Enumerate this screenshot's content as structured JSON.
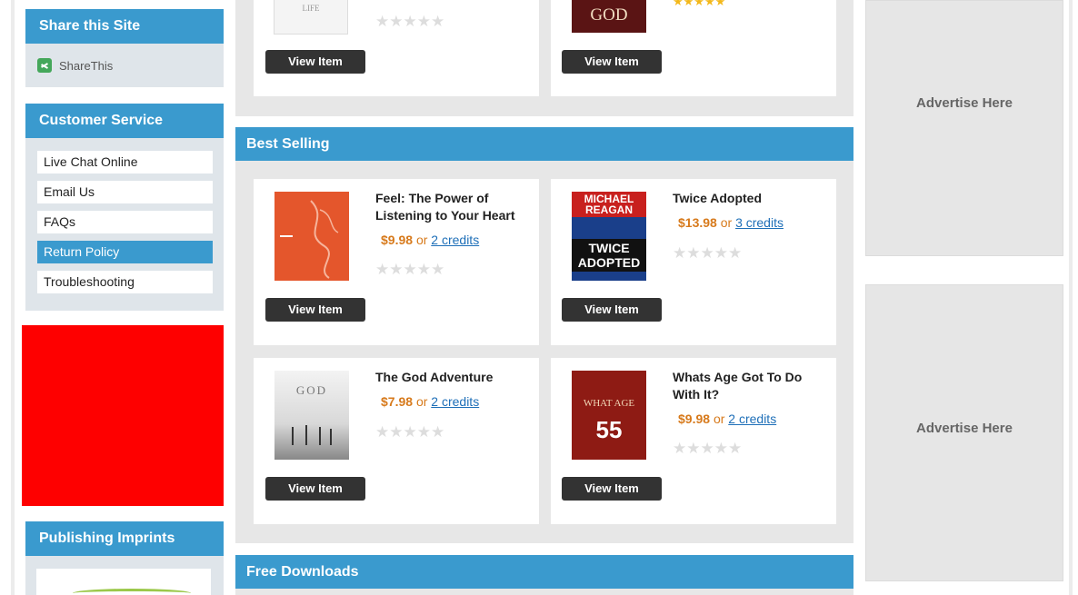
{
  "sidebar": {
    "share": {
      "heading": "Share this Site",
      "link_label": "ShareThis"
    },
    "customer_service": {
      "heading": "Customer Service",
      "items": [
        {
          "label": "Live Chat Online"
        },
        {
          "label": "Email Us"
        },
        {
          "label": "FAQs"
        },
        {
          "label": "Return Policy"
        },
        {
          "label": "Troubleshooting"
        }
      ]
    },
    "imprints": {
      "heading": "Publishing Imprints"
    }
  },
  "top_row": {
    "cover_left_text": "LIFE",
    "cover_right_text": "GOD",
    "view_label": "View Item"
  },
  "best_selling": {
    "heading": "Best Selling",
    "items": [
      {
        "title": "Feel: The Power of Listening to Your Heart",
        "price": "$9.98",
        "or": "or",
        "credits": "2 credits",
        "cover": {
          "top": "",
          "bottom": ""
        },
        "view_label": "View Item"
      },
      {
        "title": "Twice Adopted",
        "price": "$13.98",
        "or": "or",
        "credits": "3 credits",
        "cover": {
          "top": "MICHAEL REAGAN",
          "bottom": "TWICE ADOPTED"
        },
        "view_label": "View Item"
      },
      {
        "title": "The God Adventure",
        "price": "$7.98",
        "or": "or",
        "credits": "2 credits",
        "cover": {
          "top": "GOD",
          "bottom": ""
        },
        "view_label": "View Item"
      },
      {
        "title": "Whats Age Got To Do With It?",
        "price": "$9.98",
        "or": "or",
        "credits": "2 credits",
        "cover": {
          "top": "WHAT AGE",
          "bottom": "55"
        },
        "view_label": "View Item"
      }
    ]
  },
  "free_downloads": {
    "heading": "Free Downloads"
  },
  "ads": [
    {
      "label": "Advertise Here"
    },
    {
      "label": "Advertise Here"
    }
  ],
  "colors": {
    "accent": "#3a9ace",
    "price": "#d77a1c",
    "link": "#1e6fb8",
    "red_block": "#fe0000"
  }
}
